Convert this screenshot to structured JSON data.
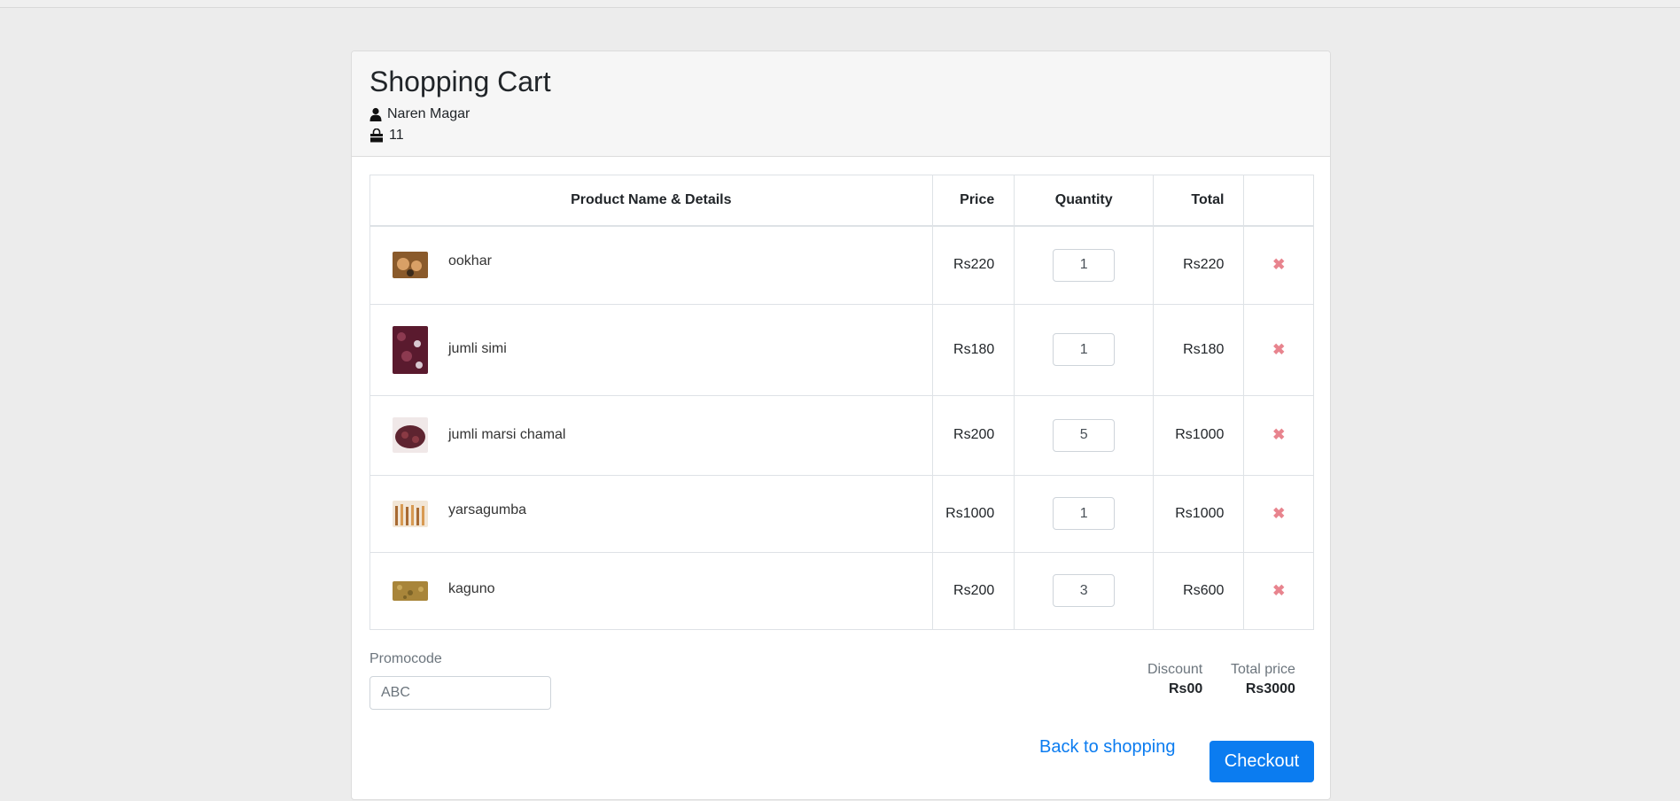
{
  "header": {
    "title": "Shopping Cart",
    "user_name": "Naren Magar",
    "bag_count": "11"
  },
  "table": {
    "columns": [
      "Product Name & Details",
      "Price",
      "Quantity",
      "Total",
      ""
    ],
    "rows": [
      {
        "name": "ookhar",
        "price": "Rs220",
        "qty": "1",
        "total": "Rs220",
        "thumb_colors": [
          "#8a5a2b",
          "#d9a066",
          "#3a2a1a"
        ]
      },
      {
        "name": "jumli simi",
        "price": "Rs180",
        "qty": "1",
        "total": "Rs180",
        "thumb_colors": [
          "#5a1a2e",
          "#8c3a50",
          "#d8c8d0"
        ]
      },
      {
        "name": "jumli marsi chamal",
        "price": "Rs200",
        "qty": "5",
        "total": "Rs1000",
        "thumb_colors": [
          "#5e2430",
          "#8a3a44",
          "#f0e8e8"
        ]
      },
      {
        "name": "yarsagumba",
        "price": "Rs1000",
        "qty": "1",
        "total": "Rs1000",
        "thumb_colors": [
          "#a86a32",
          "#d89a52",
          "#f2e6d6"
        ]
      },
      {
        "name": "kaguno",
        "price": "Rs200",
        "qty": "3",
        "total": "Rs600",
        "thumb_colors": [
          "#a8853a",
          "#c9a85a",
          "#7d6428"
        ]
      }
    ],
    "delete_symbol": "✖"
  },
  "promo": {
    "label": "Promocode",
    "placeholder": "ABC"
  },
  "summary": {
    "discount_label": "Discount",
    "discount_value": "Rs00",
    "total_label": "Total price",
    "total_value": "Rs3000"
  },
  "actions": {
    "back_label": "Back to shopping",
    "checkout_label": "Checkout"
  },
  "colors": {
    "primary": "#0b7cf0",
    "delete": "#e8848e"
  }
}
